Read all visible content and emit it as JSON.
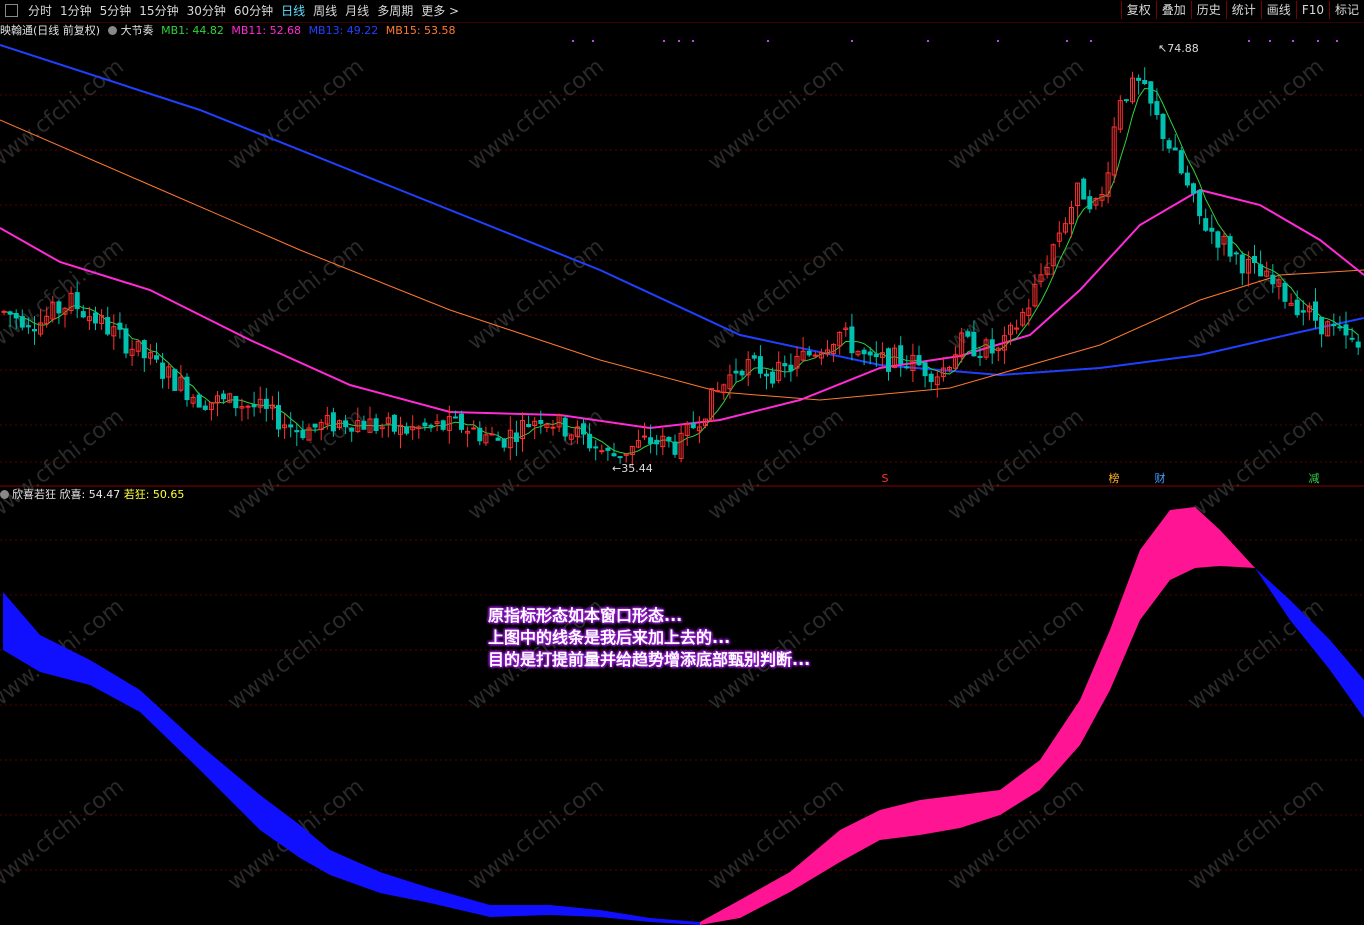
{
  "toolbar": {
    "periods": [
      "分时",
      "1分钟",
      "5分钟",
      "15分钟",
      "30分钟",
      "60分钟",
      "日线",
      "周线",
      "月线",
      "多周期",
      "更多 >"
    ],
    "active_period": "日线",
    "right_buttons": [
      "复权",
      "叠加",
      "历史",
      "统计",
      "画线",
      "F10",
      "标记"
    ]
  },
  "main_panel": {
    "stock_label": "映翰通(日线 前复权)",
    "indicator_name": "大节奏",
    "ma_items": [
      {
        "label": "MB1: 44.82",
        "color": "#2fd33c"
      },
      {
        "label": "MB11: 52.68",
        "color": "#ff2bd6"
      },
      {
        "label": "MB13: 49.22",
        "color": "#2040ff"
      },
      {
        "label": "MB15: 53.58",
        "color": "#ff7a30"
      }
    ],
    "high_label": "74.88",
    "low_label": "35.44",
    "event_markers": [
      {
        "text": "S",
        "color": "#ff3030"
      },
      {
        "text": "榜",
        "color": "#ffb020"
      },
      {
        "text": "财",
        "color": "#40a0ff"
      },
      {
        "text": "减",
        "color": "#30d040"
      }
    ]
  },
  "sub_panel": {
    "indicator_name": "欣喜若狂",
    "items": [
      {
        "label": "欣喜: 54.47",
        "color": "#e8e8e8"
      },
      {
        "label": "若狂: 50.65",
        "color": "#ffff40"
      }
    ]
  },
  "annotation": {
    "lines": [
      "原指标形态如本窗口形态...",
      "上图中的线条是我后来加上去的...",
      "目的是打提前量并给趋势增添底部甄别判断..."
    ]
  },
  "watermark": "www.cfchi.com",
  "chart_data": {
    "type": "candlestick",
    "price_high": 74.88,
    "price_low": 35.44,
    "series": [
      {
        "name": "MB1",
        "color": "#2fd33c",
        "value": 44.82
      },
      {
        "name": "MB11",
        "color": "#ff2bd6",
        "value": 52.68
      },
      {
        "name": "MB13",
        "color": "#2040ff",
        "value": 49.22
      },
      {
        "name": "MB15",
        "color": "#ff7a30",
        "value": 53.58
      }
    ],
    "sub_series": [
      {
        "name": "欣喜",
        "value": 54.47
      },
      {
        "name": "若狂",
        "value": 50.65
      }
    ],
    "colors": {
      "up": "#ff3030",
      "down": "#00c0b0",
      "band_down": "#1010ff",
      "band_up": "#ff1493"
    }
  }
}
